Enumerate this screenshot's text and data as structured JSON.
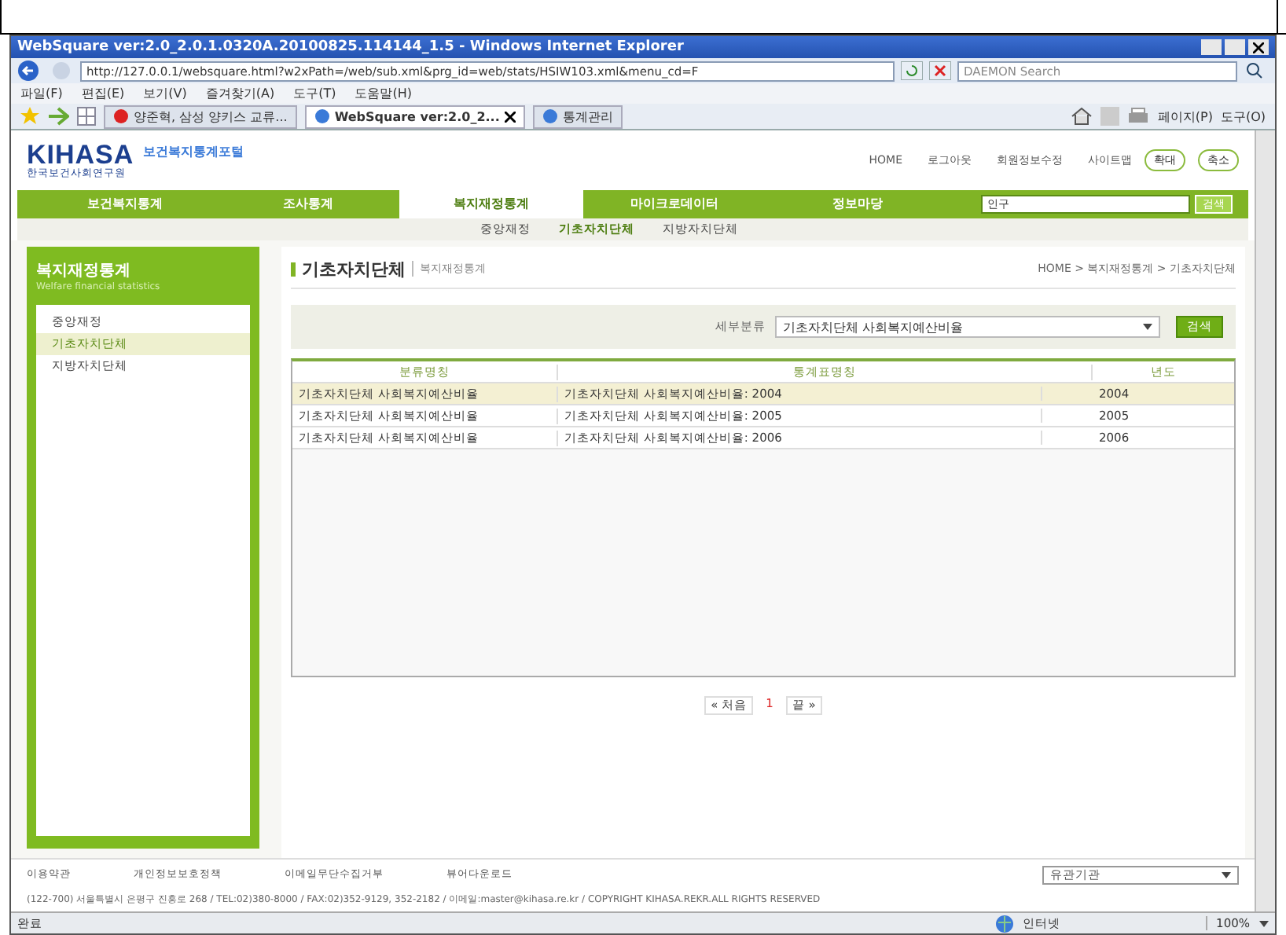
{
  "window": {
    "title": "WebSquare ver:2.0_2.0.1.0320A.20100825.114144_1.5 - Windows Internet Explorer"
  },
  "address_bar": {
    "url": "http://127.0.0.1/websquare.html?w2xPath=/web/sub.xml&prg_id=web/stats/HSIW103.xml&menu_cd=F",
    "search_placeholder": "DAEMON Search"
  },
  "menu_bar": [
    "파일(F)",
    "편집(E)",
    "보기(V)",
    "즐겨찾기(A)",
    "도구(T)",
    "도움말(H)"
  ],
  "browser_tabs": [
    {
      "label": "양준혁, 삼성 양키스 교류...",
      "selected": false
    },
    {
      "label": "WebSquare ver:2.0_2...",
      "selected": true
    },
    {
      "label": "통계관리",
      "selected": false
    }
  ],
  "command_bar": [
    "페이지(P)",
    "도구(O)"
  ],
  "site": {
    "logo": "KIHASA",
    "logo_sub": "한국보건사회연구원",
    "portal_name": "보건복지통계포털",
    "top_links": [
      "HOME",
      "로그아웃",
      "회원정보수정",
      "사이트맵"
    ],
    "zoom_buttons": [
      "확대",
      "축소"
    ],
    "nav": [
      {
        "label": "보건복지통계",
        "selected": false
      },
      {
        "label": "조사통계",
        "selected": false
      },
      {
        "label": "복지재정통계",
        "selected": true
      },
      {
        "label": "마이크로데이터",
        "selected": false
      },
      {
        "label": "정보마당",
        "selected": false
      }
    ],
    "nav_search": {
      "value": "인구",
      "button": "검색"
    },
    "subnav": [
      {
        "label": "중앙재정",
        "selected": false
      },
      {
        "label": "기초자치단체",
        "selected": true
      },
      {
        "label": "지방자치단체",
        "selected": false
      }
    ],
    "sidebar": {
      "title": "복지재정통계",
      "subtitle": "Welfare financial statistics",
      "items": [
        {
          "label": "중앙재정",
          "selected": false
        },
        {
          "label": "기초자치단체",
          "selected": true
        },
        {
          "label": "지방자치단체",
          "selected": false
        }
      ]
    },
    "page_title": "기초자치단체",
    "page_subtitle": "복지재정통계",
    "breadcrumb": "HOME > 복지재정통계 > 기초자치단체",
    "filter": {
      "label": "세부분류",
      "value": "기초자치단체 사회복지예산비율",
      "button": "검색"
    },
    "table": {
      "columns": [
        "분류명칭",
        "통계표명칭",
        "년도"
      ],
      "rows": [
        {
          "cells": [
            "기초자치단체 사회복지예산비율",
            "기초자치단체 사회복지예산비율: 2004",
            "2004"
          ],
          "selected": true
        },
        {
          "cells": [
            "기초자치단체 사회복지예산비율",
            "기초자치단체 사회복지예산비율: 2005",
            "2005"
          ],
          "selected": false
        },
        {
          "cells": [
            "기초자치단체 사회복지예산비율",
            "기초자치단체 사회복지예산비율: 2006",
            "2006"
          ],
          "selected": false
        }
      ]
    },
    "pagination": {
      "first": "« 처음",
      "pages": [
        "1"
      ],
      "last": "끝 »"
    },
    "footer": {
      "links": [
        "이용약관",
        "개인정보보호정책",
        "이메일무단수집거부",
        "뷰어다운로드"
      ],
      "related_select": "유관기관",
      "address": "(122-700) 서울특별시 은평구 진흥로 268  /  TEL:02)380-8000  /  FAX:02)352-9129, 352-2182  /  이메일:master@kihasa.re.kr  /  COPYRIGHT KIHASA.REKR.ALL RIGHTS RESERVED"
    }
  },
  "status_bar": {
    "status": "완료",
    "zone": "인터넷",
    "zoom": "100%"
  }
}
